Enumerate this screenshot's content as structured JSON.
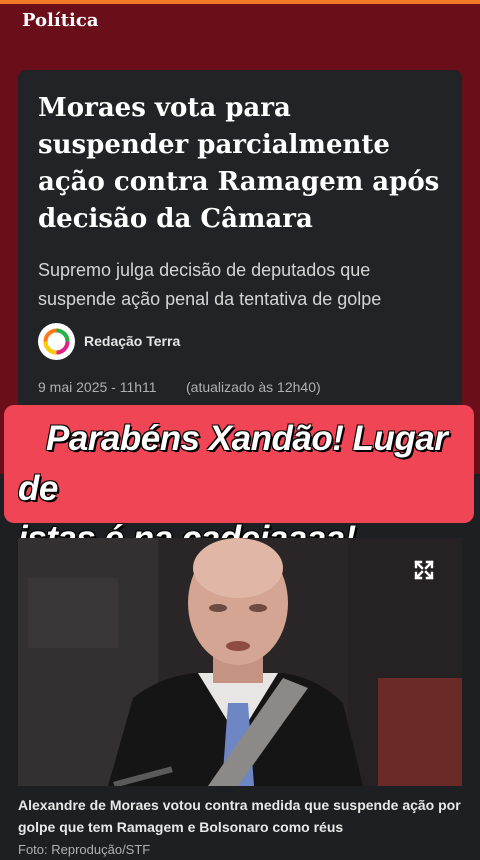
{
  "section": {
    "label": "Política"
  },
  "article": {
    "headline": "Moraes vota para suspender parcialmente ação contra Ramagem após decisão da Câmara",
    "subhead": "Supremo julga decisão de deputados que suspende ação penal da tentativa de golpe",
    "author": "Redação Terra",
    "date": "9 mai 2025 - 11h11",
    "updated": "(atualizado às 12h40)"
  },
  "overlay": {
    "line1": "Parabéns Xandão! Lugar de",
    "line2": "istas é na cadeiaaaa!"
  },
  "image": {
    "caption": "Alexandre de Moraes votou contra medida que suspende ação por golpe que tem Ramagem e Bolsonaro como réus",
    "credit": "Foto: Reprodução/STF"
  },
  "colors": {
    "accent_top": "#f07826",
    "header_bg": "#6a0f1a",
    "overlay_bg": "#f04555"
  },
  "icons": {
    "author_logo": "terra-logo-icon",
    "expand": "expand-icon"
  }
}
